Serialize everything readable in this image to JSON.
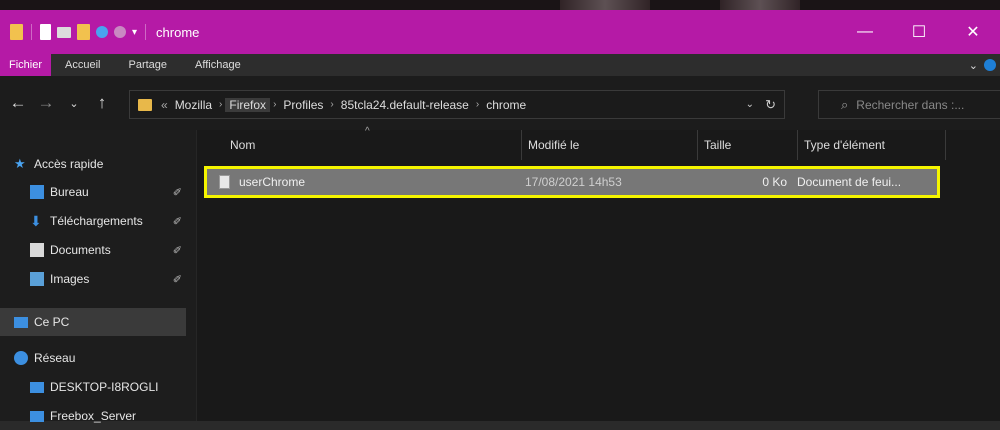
{
  "window": {
    "title": "chrome",
    "accent_color": "#b51aa6",
    "controls": {
      "minimize": "—",
      "maximize": "☐",
      "close": "✕"
    }
  },
  "menu": {
    "items": [
      "Fichier",
      "Accueil",
      "Partage",
      "Affichage"
    ],
    "active_index": 0
  },
  "address": {
    "overflow": "«",
    "crumbs": [
      "Mozilla",
      "Firefox",
      "Profiles",
      "85tcla24.default-release",
      "chrome"
    ],
    "selected_crumb_index": 1
  },
  "search": {
    "placeholder": "Rechercher dans :..."
  },
  "sidebar": {
    "items": [
      {
        "label": "Accès rapide",
        "icon": "star-icon",
        "pinned": false
      },
      {
        "label": "Bureau",
        "icon": "desktop-folder-icon",
        "pinned": true
      },
      {
        "label": "Téléchargements",
        "icon": "download-icon",
        "pinned": true
      },
      {
        "label": "Documents",
        "icon": "documents-icon",
        "pinned": true
      },
      {
        "label": "Images",
        "icon": "images-icon",
        "pinned": true
      },
      {
        "label": "Ce PC",
        "icon": "computer-icon",
        "pinned": false,
        "selected": true
      },
      {
        "label": "Réseau",
        "icon": "network-icon",
        "pinned": false
      },
      {
        "label": "DESKTOP-I8ROGLI",
        "icon": "computer-icon",
        "pinned": false
      },
      {
        "label": "Freebox_Server",
        "icon": "computer-icon",
        "pinned": false
      }
    ]
  },
  "files": {
    "columns": [
      "Nom",
      "Modifié le",
      "Taille",
      "Type d'élément"
    ],
    "rows": [
      {
        "name": "userChrome",
        "modified": "17/08/2021 14h53",
        "size": "0 Ko",
        "type": "Document de feui..."
      }
    ]
  },
  "highlight_color": "#f5f500"
}
